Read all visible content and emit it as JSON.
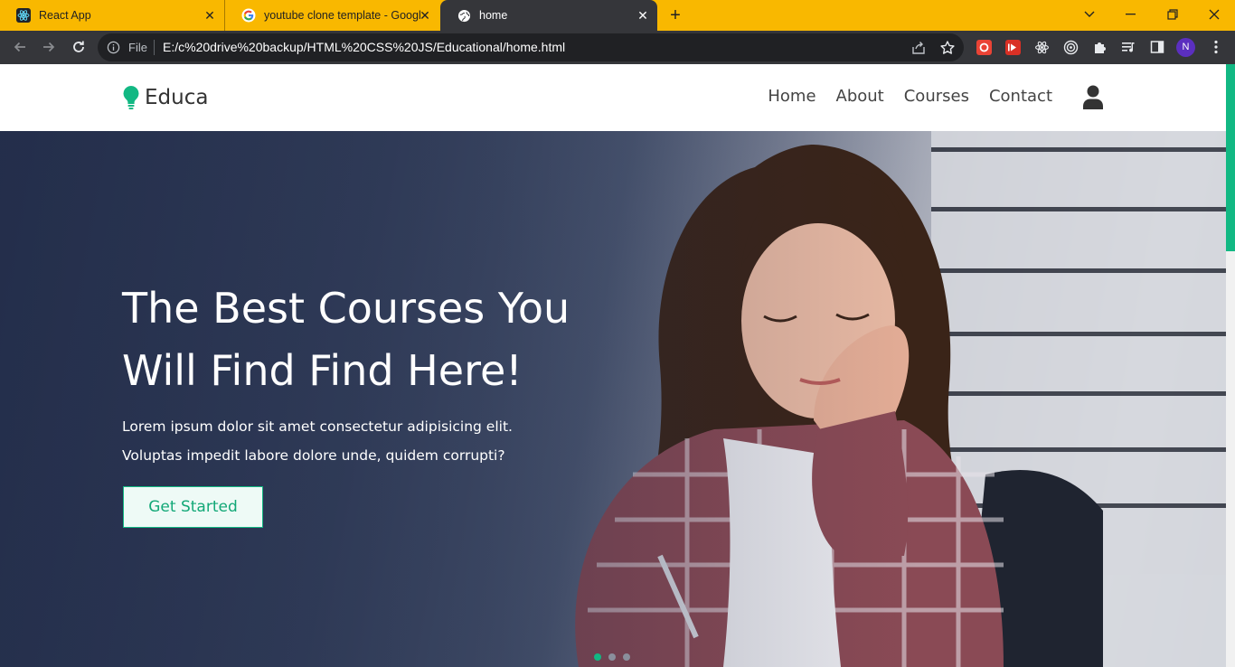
{
  "browser": {
    "tabs": [
      {
        "title": "React App",
        "icon": "react-icon"
      },
      {
        "title": "youtube clone template - Google",
        "icon": "google-icon"
      },
      {
        "title": "home",
        "icon": "globe-icon",
        "active": true
      }
    ],
    "address_bar": {
      "scheme_label": "File",
      "url": "E:/c%20drive%20backup/HTML%20CSS%20JS/Educational/home.html"
    },
    "profile_initial": "N",
    "colors": {
      "tab_strip": "#f9b800",
      "toolbar": "#35363a"
    }
  },
  "site": {
    "brand": "Educa",
    "nav": [
      "Home",
      "About",
      "Courses",
      "Contact"
    ],
    "hero": {
      "title": "The Best Courses You Will Find Find Here!",
      "text": "Lorem ipsum dolor sit amet consectetur adipisicing elit. Voluptas impedit labore dolore unde, quidem corrupti?",
      "cta_label": "Get Started"
    },
    "carousel": {
      "slides": 3,
      "active_index": 0
    },
    "accent_color": "#12b883"
  }
}
